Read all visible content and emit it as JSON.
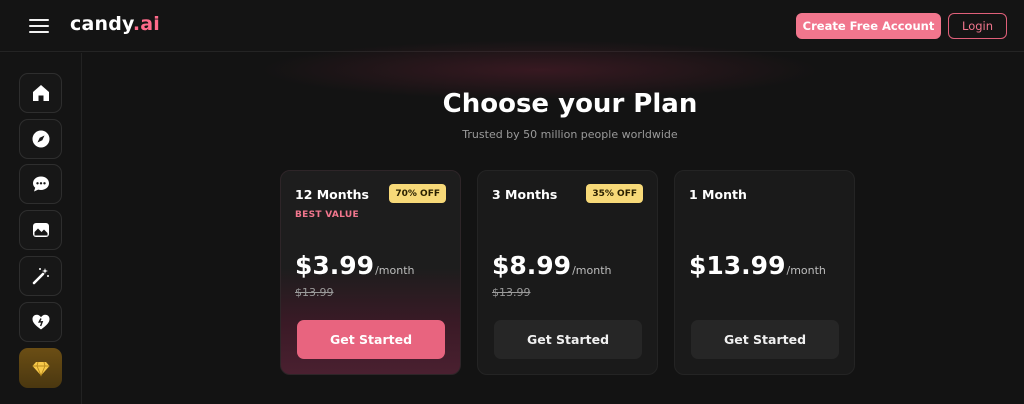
{
  "header": {
    "logo_main": "candy",
    "logo_accent": ".ai",
    "create_account_label": "Create Free Account",
    "login_label": "Login"
  },
  "sidebar": {
    "items": [
      {
        "icon": "home-icon"
      },
      {
        "icon": "compass-icon"
      },
      {
        "icon": "chat-icon"
      },
      {
        "icon": "gallery-icon"
      },
      {
        "icon": "magic-wand-icon"
      },
      {
        "icon": "heart-icon"
      },
      {
        "icon": "diamond-icon"
      }
    ]
  },
  "main": {
    "title": "Choose your Plan",
    "subtitle": "Trusted by 50 million people worldwide"
  },
  "plans": [
    {
      "name": "12 Months",
      "badge": "70% OFF",
      "tag": "BEST VALUE",
      "price": "$3.99",
      "period": "/month",
      "old_price": "$13.99",
      "cta": "Get Started"
    },
    {
      "name": "3 Months",
      "badge": "35% OFF",
      "price": "$8.99",
      "period": "/month",
      "old_price": "$13.99",
      "cta": "Get Started"
    },
    {
      "name": "1 Month",
      "price": "$13.99",
      "period": "/month",
      "cta": "Get Started"
    }
  ],
  "colors": {
    "accent": "#f1768d",
    "background": "#131313",
    "badge": "#f7d978",
    "premium_gold": "#6b4e14"
  }
}
